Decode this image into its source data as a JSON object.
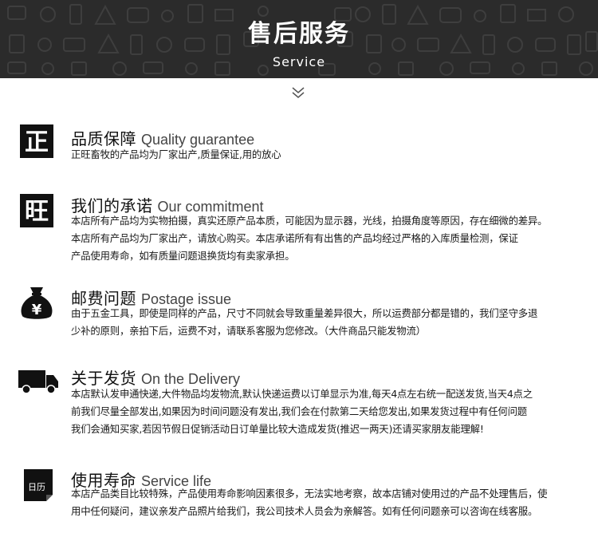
{
  "banner": {
    "title": "售后服务",
    "subtitle": "Service"
  },
  "icons": {
    "zheng": {
      "glyph": "正",
      "name": "zheng-seal-icon"
    },
    "wang": {
      "glyph": "旺",
      "name": "wang-seal-icon"
    },
    "yuan": {
      "glyph": "¥",
      "name": "money-bag-icon"
    },
    "calendar": {
      "label": "日历",
      "name": "calendar-icon"
    }
  },
  "sections": [
    {
      "title_cn": "品质保障",
      "title_en": "Quality guarantee",
      "lines": [
        "正旺畜牧的产品均为厂家出产,质量保证,用的放心"
      ]
    },
    {
      "title_cn": "我们的承诺",
      "title_en": "Our commitment",
      "lines": [
        "本店所有产品均为实物拍摄，真实还原产品本质，可能因为显示器，光线，拍摄角度等原因，存在细微的差异。",
        "本店所有产品均为厂家出产，请放心购买。本店承诺所有有出售的产品均经过严格的入库质量检测，保证",
        "产品使用寿命，如有质量问题退换货均有卖家承担。"
      ]
    },
    {
      "title_cn": "邮费问题",
      "title_en": "Postage issue",
      "lines": [
        "由于五金工具，即使是同样的产品，尺寸不同就会导致重量差异很大，所以运费部分都是错的，我们坚守多退",
        "少补的原则，亲拍下后，运费不对，请联系客服为您修改。（大件商品只能发物流）"
      ]
    },
    {
      "title_cn": "关于发货",
      "title_en": "On the Delivery",
      "lines": [
        "本店默认发申通快递,大件物品均发物流,默认快递运费以订单显示为准,每天4点左右统一配送发货,当天4点之",
        "前我们尽量全部发出,如果因为时间问题没有发出,我们会在付款第二天给您发出,如果发货过程中有任何问题",
        "我们会通知买家,若因节假日促销活动日订单量比较大造成发货(推迟一两天)还请买家朋友能理解!"
      ]
    },
    {
      "title_cn": "使用寿命",
      "title_en": "Service life",
      "lines": [
        "本店产品类目比较特殊，产品使用寿命影响因素很多，无法实地考察，故本店铺对使用过的产品不处理售后，使",
        "用中任何疑问，建议亲发产品照片给我们，我公司技术人员会为亲解答。如有任何问题亲可以咨询在线客服。"
      ]
    }
  ]
}
